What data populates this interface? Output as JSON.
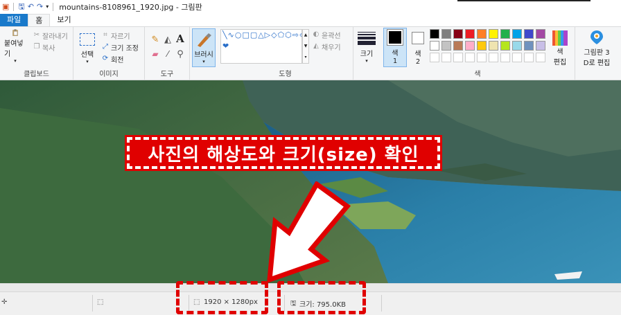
{
  "titlebar": {
    "title": "mountains-8108961_1920.jpg - 그림판"
  },
  "tabs": {
    "file": "파일",
    "home": "홈",
    "view": "보기"
  },
  "clipboard": {
    "paste": "붙여넣기",
    "cut": "잘라내기",
    "copy": "복사",
    "group": "클립보드"
  },
  "image": {
    "select": "선택",
    "crop": "자르기",
    "resize": "크기 조정",
    "rotate": "회전",
    "group": "이미지"
  },
  "tools": {
    "group": "도구",
    "brush": "브러시"
  },
  "shapes": {
    "outline": "윤곽선",
    "fill": "채우기",
    "group": "도형"
  },
  "size": {
    "label": "크기"
  },
  "colors": {
    "color1": "색",
    "color1_num": "1",
    "color2": "색",
    "color2_num": "2",
    "edit1": "색",
    "edit2": "편집",
    "paint3d1": "그림판 3",
    "paint3d2": "D로 편집",
    "group": "색",
    "palette_row1": [
      "#000000",
      "#7f7f7f",
      "#880015",
      "#ed1c24",
      "#ff7f27",
      "#fff200",
      "#22b14c",
      "#00a2e8",
      "#3f48cc",
      "#a349a4"
    ],
    "palette_row2": [
      "#ffffff",
      "#c3c3c3",
      "#b97a57",
      "#ffaec9",
      "#ffc90e",
      "#efe4b0",
      "#b5e61d",
      "#99d9ea",
      "#7092be",
      "#c8bfe7"
    ],
    "accent": "#1979ca"
  },
  "annotation": {
    "callout": "사진의 해상도와 크기(size) 확인",
    "highlight_color": "#e00000"
  },
  "statusbar": {
    "dimensions": "1920 × 1280px",
    "filesize": "크기: 795.0KB"
  }
}
